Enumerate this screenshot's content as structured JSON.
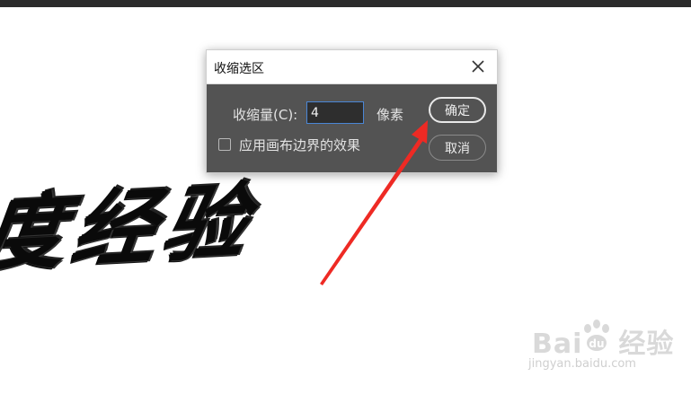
{
  "canvas": {
    "calligraphy_text": "度经验"
  },
  "dialog": {
    "title": "收缩选区",
    "contract_label": "收缩量(C):",
    "contract_value": "4",
    "unit_label": "像素",
    "checkbox_label": "应用画布边界的效果",
    "checkbox_checked": false,
    "ok_label": "确定",
    "cancel_label": "取消"
  },
  "icons": {
    "close": "close-icon",
    "arrow": "red-arrow-annotation",
    "watermark_paw": "paw-icon"
  },
  "colors": {
    "dialog_bg": "#535353",
    "arrow": "#ee2a24",
    "input_border": "#4a86d6"
  },
  "watermark": {
    "logo_left": "Bai",
    "logo_right": "经验",
    "domain": "jingyan.baidu.com"
  }
}
